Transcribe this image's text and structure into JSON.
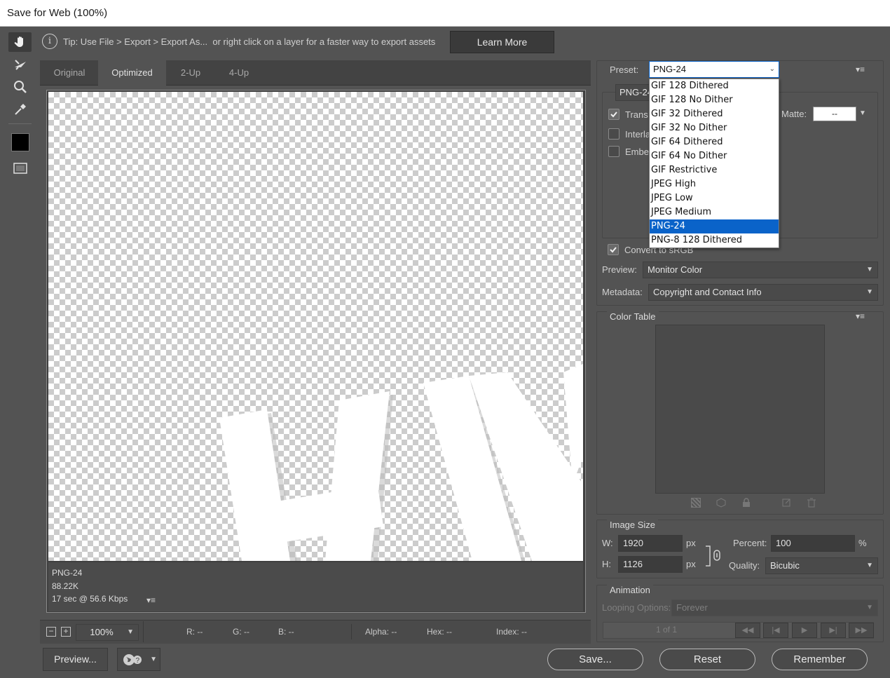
{
  "window": {
    "title": "Save for Web (100%)"
  },
  "tip": {
    "text": "Tip: Use File > Export > Export As...  or right click on a layer for a faster way to export assets",
    "learn_more": "Learn More"
  },
  "tools": [
    "hand-tool",
    "slice-select-tool",
    "zoom-tool",
    "eyedropper-tool",
    "eyedropper-color",
    "toggle-slices"
  ],
  "tabs": [
    {
      "label": "Original"
    },
    {
      "label": "Optimized"
    },
    {
      "label": "2-Up"
    },
    {
      "label": "4-Up"
    }
  ],
  "info": {
    "format": "PNG-24",
    "size": "88.22K",
    "time": "17 sec @ 56.6 Kbps"
  },
  "status": {
    "zoom": "100%",
    "r": "R: --",
    "g": "G: --",
    "b": "B: --",
    "alpha": "Alpha: --",
    "hex": "Hex: --",
    "index": "Index: --"
  },
  "buttons": {
    "preview": "Preview...",
    "save": "Save...",
    "reset": "Reset",
    "remember": "Remember"
  },
  "settings": {
    "preset_label": "Preset:",
    "preset_value": "PNG-24",
    "format_value": "PNG-24",
    "transparency_label": "Trans",
    "interlaced_label": "Interla",
    "embed_label": "Embe",
    "matte_label": "Matte:",
    "matte_value": "--",
    "convert_srgb_label": "Convert to sRGB",
    "preview_label": "Preview:",
    "preview_value": "Monitor Color",
    "metadata_label": "Metadata:",
    "metadata_value": "Copyright and Contact Info",
    "color_table_label": "Color Table"
  },
  "preset_options": [
    "GIF 128 Dithered",
    "GIF 128 No Dither",
    "GIF 32 Dithered",
    "GIF 32 No Dither",
    "GIF 64 Dithered",
    "GIF 64 No Dither",
    "GIF Restrictive",
    "JPEG High",
    "JPEG Low",
    "JPEG Medium",
    "PNG-24",
    "PNG-8 128 Dithered"
  ],
  "preset_selected_index": 10,
  "image_size": {
    "label": "Image Size",
    "w_label": "W:",
    "w_value": "1920",
    "h_label": "H:",
    "h_value": "1126",
    "unit": "px",
    "percent_label": "Percent:",
    "percent_value": "100",
    "percent_unit": "%",
    "quality_label": "Quality:",
    "quality_value": "Bicubic"
  },
  "animation": {
    "label": "Animation",
    "looping_label": "Looping Options:",
    "looping_value": "Forever",
    "frame": "1 of 1"
  },
  "colors": {
    "accent": "#0a63c9",
    "panel": "#535353",
    "dark": "#3c3c3c"
  }
}
